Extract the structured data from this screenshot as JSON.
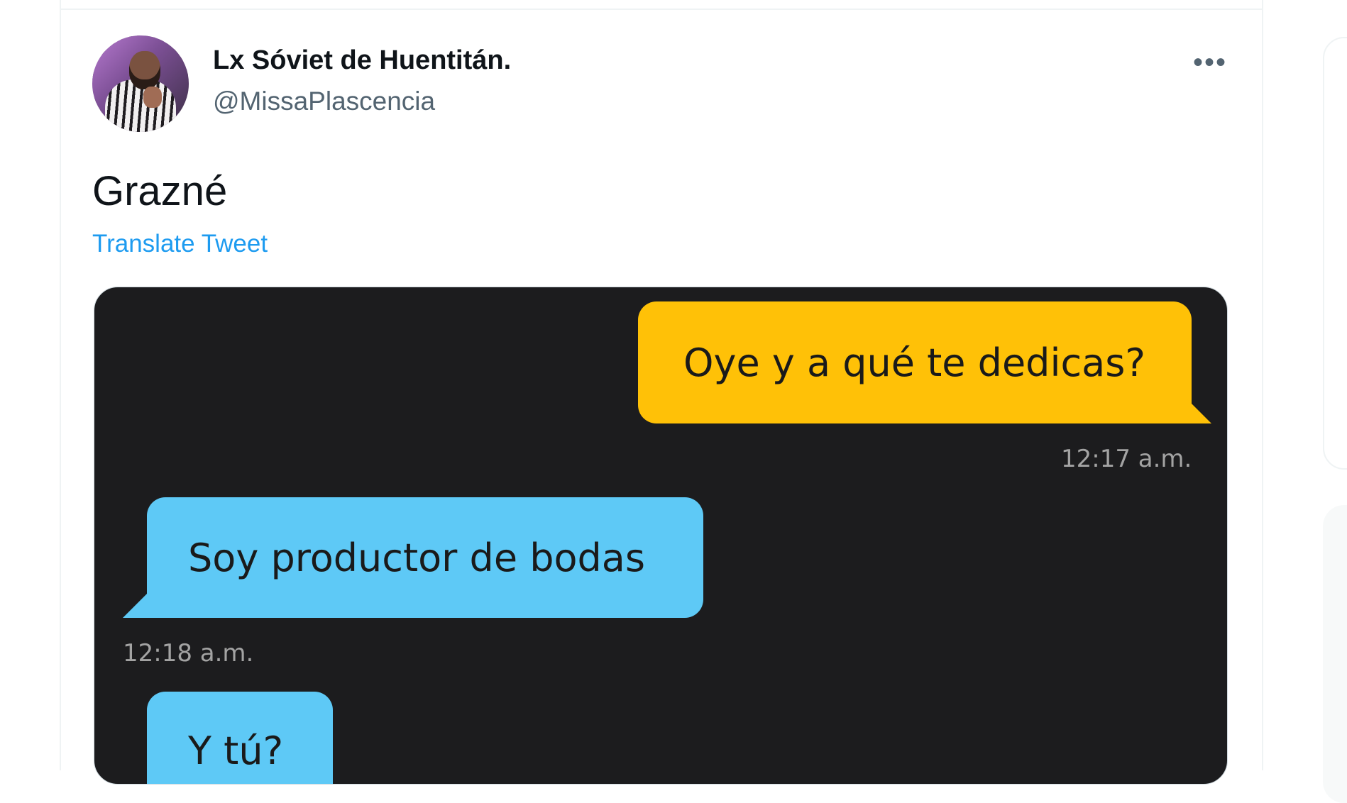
{
  "tweet": {
    "author_name": "Lx Sóviet de Huentitán.",
    "author_handle": "@MissaPlascencia",
    "text": "Grazné",
    "translate_label": "Translate Tweet",
    "more_icon": "more-horizontal-icon"
  },
  "chat": {
    "messages": [
      {
        "text": "Oye y a qué te dedicas?",
        "sender": "me",
        "color": "#ffc107"
      },
      {
        "text": "Soy productor de bodas",
        "sender": "other",
        "color": "#5ec9f6"
      },
      {
        "text": "Y tú?",
        "sender": "other",
        "color": "#5ec9f6"
      }
    ],
    "timestamps": [
      "12:17 a.m.",
      "12:18 a.m."
    ],
    "background": "#1c1c1e"
  }
}
